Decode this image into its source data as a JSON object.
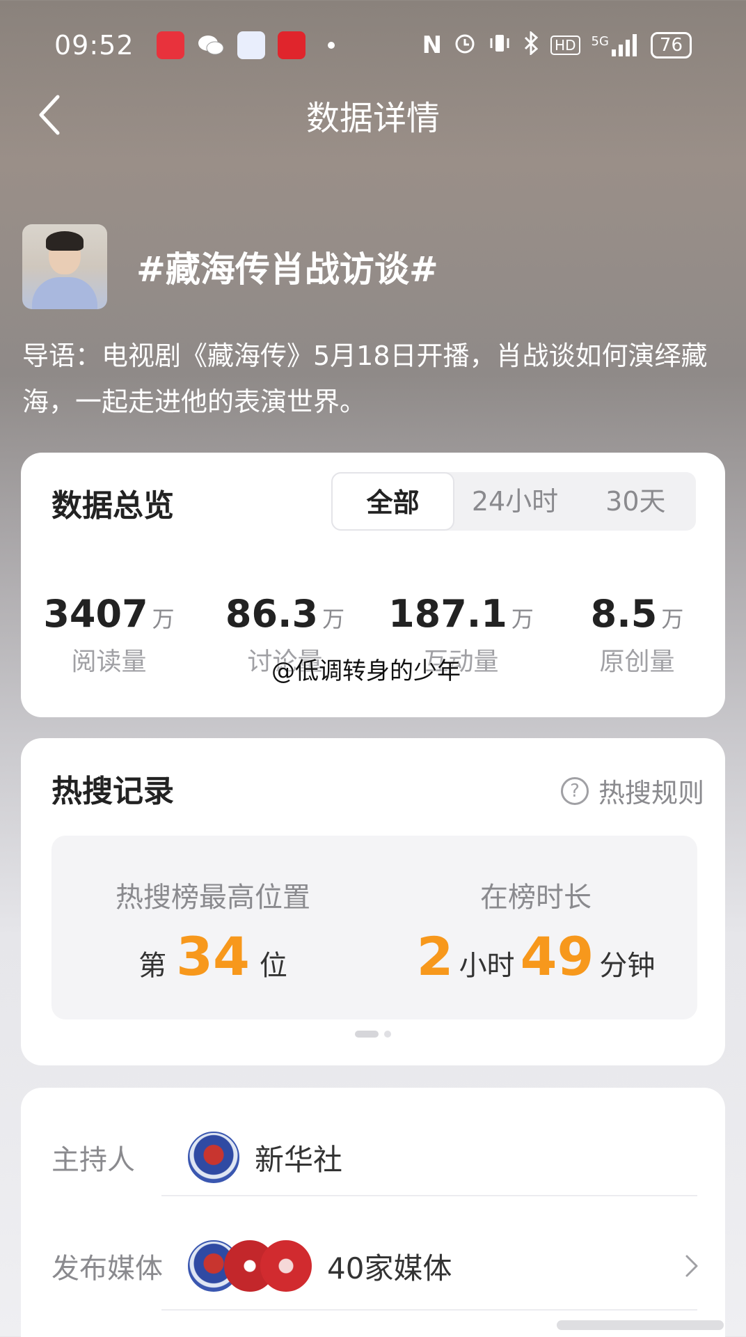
{
  "status_bar": {
    "time": "09:52",
    "battery": "76",
    "signal": "5G",
    "hd": "HD",
    "nfc": "N"
  },
  "nav": {
    "title": "数据详情"
  },
  "topic": {
    "title": "#藏海传肖战访谈#",
    "intro": "导语：电视剧《藏海传》5月18日开播，肖战谈如何演绎藏海，一起走进他的表演世界。"
  },
  "overview": {
    "title": "数据总览",
    "tabs": [
      "全部",
      "24小时",
      "30天"
    ],
    "selected_tab": "全部",
    "stats": [
      {
        "value": "3407",
        "unit": "万",
        "label": "阅读量"
      },
      {
        "value": "86.3",
        "unit": "万",
        "label": "讨论量"
      },
      {
        "value": "187.1",
        "unit": "万",
        "label": "互动量"
      },
      {
        "value": "8.5",
        "unit": "万",
        "label": "原创量"
      }
    ]
  },
  "watermark": "@低调转身的少年",
  "hot_search": {
    "title": "热搜记录",
    "rule_link": "热搜规则",
    "highest_label": "热搜榜最高位置",
    "highest_prefix": "第",
    "highest_value": "34",
    "highest_suffix": "位",
    "duration_label": "在榜时长",
    "duration_hours": "2",
    "duration_hours_unit": "小时",
    "duration_minutes": "49",
    "duration_minutes_unit": "分钟"
  },
  "host": {
    "host_label": "主持人",
    "host_name": "新华社",
    "media_label": "发布媒体",
    "media_name": "40家媒体"
  },
  "colors": {
    "accent": "#f7981c",
    "muted": "#8a8a8e"
  }
}
